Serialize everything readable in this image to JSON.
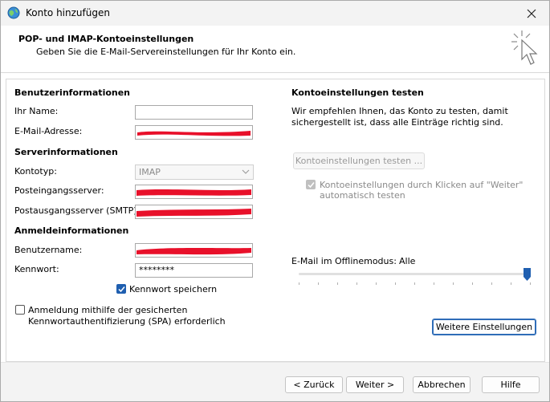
{
  "window": {
    "title": "Konto hinzufügen"
  },
  "header": {
    "title": "POP- und IMAP-Kontoeinstellungen",
    "subtitle": "Geben Sie die E-Mail-Servereinstellungen für Ihr Konto ein."
  },
  "user_info": {
    "heading": "Benutzerinformationen",
    "name_label": "Ihr Name:",
    "name_value": "",
    "email_label": "E-Mail-Adresse:"
  },
  "server_info": {
    "heading": "Serverinformationen",
    "account_type_label": "Kontotyp:",
    "account_type_value": "IMAP",
    "incoming_label": "Posteingangsserver:",
    "outgoing_label": "Postausgangsserver (SMTP):"
  },
  "login_info": {
    "heading": "Anmeldeinformationen",
    "username_label": "Benutzername:",
    "password_label": "Kennwort:",
    "password_value": "********",
    "remember_password_label": "Kennwort speichern",
    "remember_password_checked": true,
    "spa_label_line1": "Anmeldung mithilfe der gesicherten",
    "spa_label_line2": "Kennwortauthentifizierung (SPA) erforderlich",
    "spa_checked": false
  },
  "test_settings": {
    "heading": "Kontoeinstellungen testen",
    "description_line1": "Wir empfehlen Ihnen, das Konto zu testen, damit",
    "description_line2": "sichergestellt ist, dass alle Einträge richtig sind.",
    "test_button_label": "Kontoeinstellungen testen ...",
    "auto_test_label_line1": "Kontoeinstellungen durch Klicken auf \"Weiter\"",
    "auto_test_label_line2": "automatisch testen",
    "auto_test_checked": true
  },
  "offline": {
    "label": "E-Mail im Offlinemodus:",
    "value": "Alle",
    "slider_fraction": 1.0
  },
  "more_settings_button_label": "Weitere Einstellungen",
  "footer": {
    "back_label": "< Zurück",
    "next_label": "Weiter >",
    "cancel_label": "Abbrechen",
    "help_label": "Hilfe"
  },
  "colors": {
    "accent": "#1f5fb0",
    "redaction": "#e8102a"
  }
}
